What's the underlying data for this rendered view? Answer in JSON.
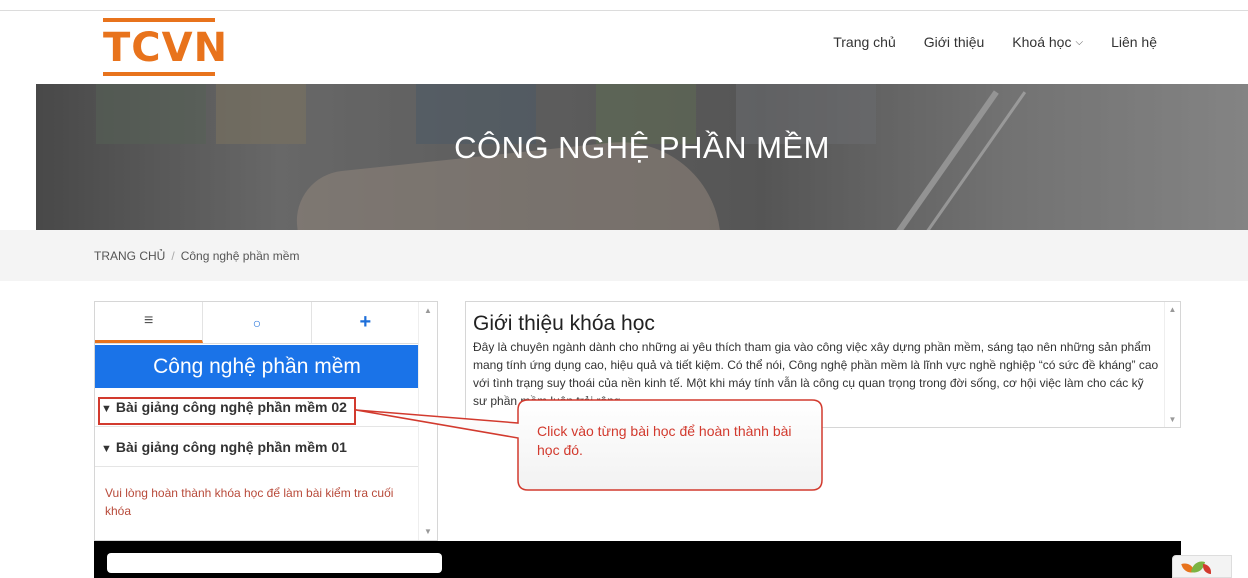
{
  "header": {
    "logo_text": "TCVN",
    "nav": [
      {
        "label": "Trang chủ"
      },
      {
        "label": "Giới thiệu"
      },
      {
        "label": "Khoá học"
      },
      {
        "label": "Liên hệ"
      }
    ]
  },
  "banner": {
    "title": "CÔNG NGHỆ PHẦN MỀM"
  },
  "breadcrumb": {
    "home": "TRANG CHỦ",
    "separator": "/",
    "current": "Công nghệ phần mềm"
  },
  "sidebar": {
    "tabs": [
      {
        "icon": "menu-icon",
        "glyph": "≡"
      },
      {
        "icon": "comment-icon",
        "glyph": "○"
      },
      {
        "icon": "plus-icon",
        "glyph": "+"
      }
    ],
    "heading": "Công nghệ phần mềm",
    "lessons": [
      {
        "label": "Bài giảng công nghệ phần mềm 02"
      },
      {
        "label": "Bài giảng công nghệ phần mềm 01"
      }
    ],
    "notice": "Vui lòng hoàn thành khóa học để làm bài kiểm tra cuối khóa"
  },
  "intro": {
    "title": "Giới thiệu khóa học",
    "body": "Đây là chuyên ngành dành cho những ai yêu thích tham gia vào công việc xây dựng phần mềm, sáng tạo nên những sản phẩm mang tính ứng dụng cao, hiệu quả và tiết kiệm. Có thể nói, Công nghệ phần mềm là lĩnh vực nghề nghiệp “có sức đề kháng” cao với tình trạng suy thoái của nền kinh tế. Một khi máy tính vẫn là công cụ quan trọng trong đời sống, cơ hội việc làm cho các kỹ sư phần mềm luôn trải rộng."
  },
  "annotation": {
    "callout_text": "Click vào từng bài học để hoàn thành bài học đó."
  },
  "colors": {
    "accent_orange": "#e8731c",
    "heading_blue": "#1a73e8",
    "annotation_red": "#d23a2e"
  }
}
